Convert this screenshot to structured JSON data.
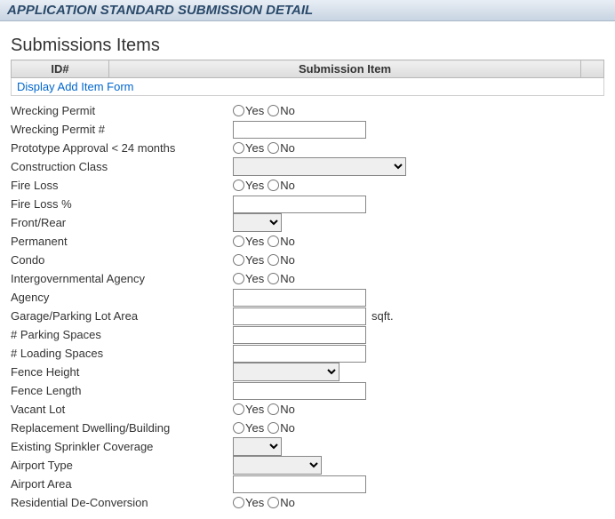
{
  "header": {
    "title": "APPLICATION STANDARD SUBMISSION DETAIL"
  },
  "submissions": {
    "section_title": "Submissions Items",
    "columns": {
      "id": "ID#",
      "item": "Submission Item"
    },
    "add_link": "Display Add Item Form"
  },
  "yesno": {
    "yes": "Yes",
    "no": "No"
  },
  "fields": {
    "wrecking_permit": {
      "label": "Wrecking Permit"
    },
    "wrecking_permit_num": {
      "label": "Wrecking Permit #",
      "value": ""
    },
    "prototype_approval": {
      "label": "Prototype Approval < 24 months"
    },
    "construction_class": {
      "label": "Construction Class"
    },
    "fire_loss": {
      "label": "Fire Loss"
    },
    "fire_loss_pct": {
      "label": "Fire Loss %",
      "value": ""
    },
    "front_rear": {
      "label": "Front/Rear"
    },
    "permanent": {
      "label": "Permanent"
    },
    "condo": {
      "label": "Condo"
    },
    "intergov_agency": {
      "label": "Intergovernmental Agency"
    },
    "agency": {
      "label": "Agency",
      "value": ""
    },
    "garage_area": {
      "label": "Garage/Parking Lot Area",
      "value": "",
      "suffix": "sqft."
    },
    "parking_spaces": {
      "label": "# Parking Spaces",
      "value": ""
    },
    "loading_spaces": {
      "label": "# Loading Spaces",
      "value": ""
    },
    "fence_height": {
      "label": "Fence Height"
    },
    "fence_length": {
      "label": "Fence Length",
      "value": ""
    },
    "vacant_lot": {
      "label": "Vacant Lot"
    },
    "replacement_dwelling": {
      "label": "Replacement Dwelling/Building"
    },
    "sprinkler_coverage": {
      "label": "Existing Sprinkler Coverage"
    },
    "airport_type": {
      "label": "Airport Type"
    },
    "airport_area": {
      "label": "Airport Area",
      "value": ""
    },
    "residential_deconv": {
      "label": "Residential De-Conversion"
    }
  }
}
